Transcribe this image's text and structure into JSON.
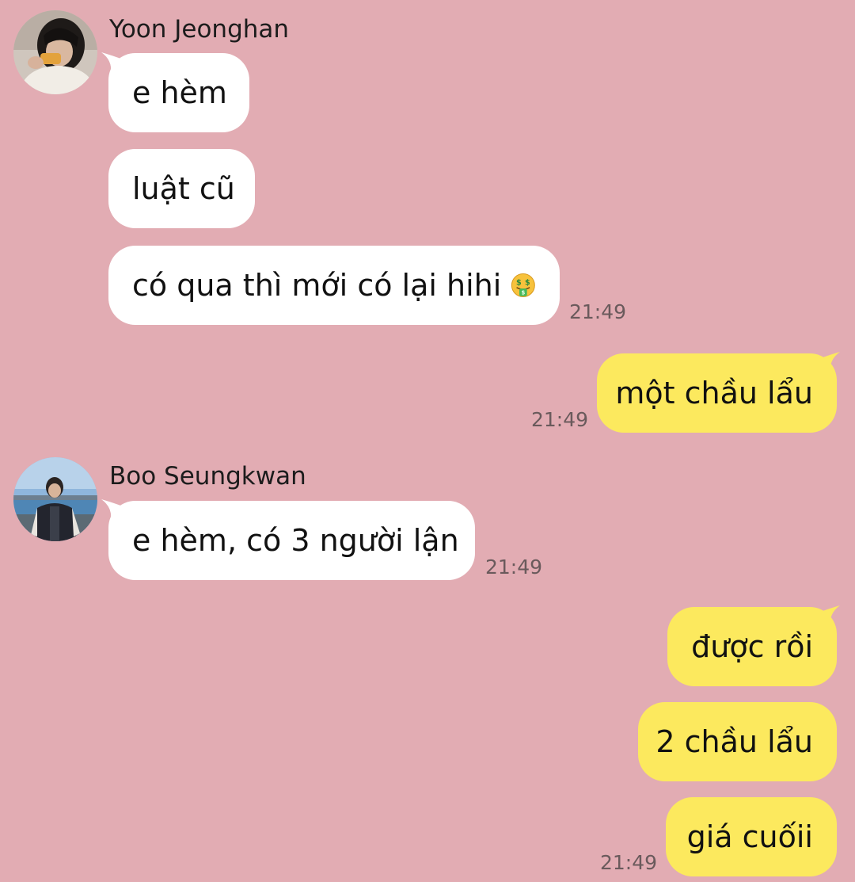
{
  "chat": {
    "groups": [
      {
        "sender": "Yoon Jeonghan",
        "avatar_icon": "profile-photo-eating",
        "messages": [
          {
            "text": "e hèm"
          },
          {
            "text": "luật cũ"
          },
          {
            "text": "có qua thì mới có lại hihi",
            "emoji": "money-mouth-face",
            "time": "21:49"
          }
        ]
      },
      {
        "sender": "me",
        "messages": [
          {
            "text": "một chầu lẩu",
            "time": "21:49"
          }
        ]
      },
      {
        "sender": "Boo Seungkwan",
        "avatar_icon": "profile-photo-riverside",
        "messages": [
          {
            "text": "e hèm, có 3 người lận",
            "time": "21:49"
          }
        ]
      },
      {
        "sender": "me",
        "messages": [
          {
            "text": "được rồi"
          },
          {
            "text": "2 chầu lẩu"
          },
          {
            "text": "giá cuốii",
            "time": "21:49"
          }
        ]
      }
    ]
  },
  "colors": {
    "background": "#e2acb3",
    "incoming_bubble": "#ffffff",
    "outgoing_bubble": "#fce95e",
    "timestamp": "#6a5a5c"
  }
}
